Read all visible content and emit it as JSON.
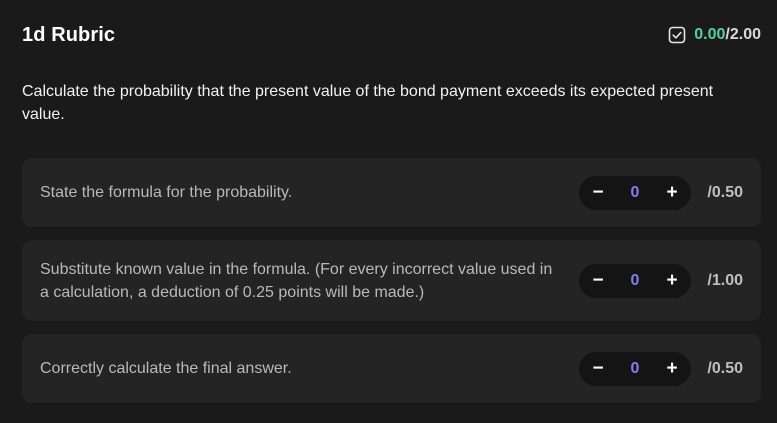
{
  "rubric": {
    "title": "1d Rubric",
    "score_earned": "0.00",
    "score_total": "/2.00",
    "question": "Calculate the probability that the present value of the bond payment exceeds its expected present value."
  },
  "criteria": [
    {
      "text": "State the formula for the probability.",
      "decrement": "−",
      "value": "0",
      "increment": "+",
      "max": "/0.50"
    },
    {
      "text": "Substitute known value in the formula. (For every incorrect value used in a calculation, a deduction of 0.25 points will be made.)",
      "decrement": "−",
      "value": "0",
      "increment": "+",
      "max": "/1.00"
    },
    {
      "text": "Correctly calculate the final answer.",
      "decrement": "−",
      "value": "0",
      "increment": "+",
      "max": "/0.50"
    }
  ],
  "colors": {
    "background": "#1a1a1b",
    "card": "#242425",
    "earned_green": "#4fd3a1",
    "value_purple": "#8a7cf0"
  }
}
